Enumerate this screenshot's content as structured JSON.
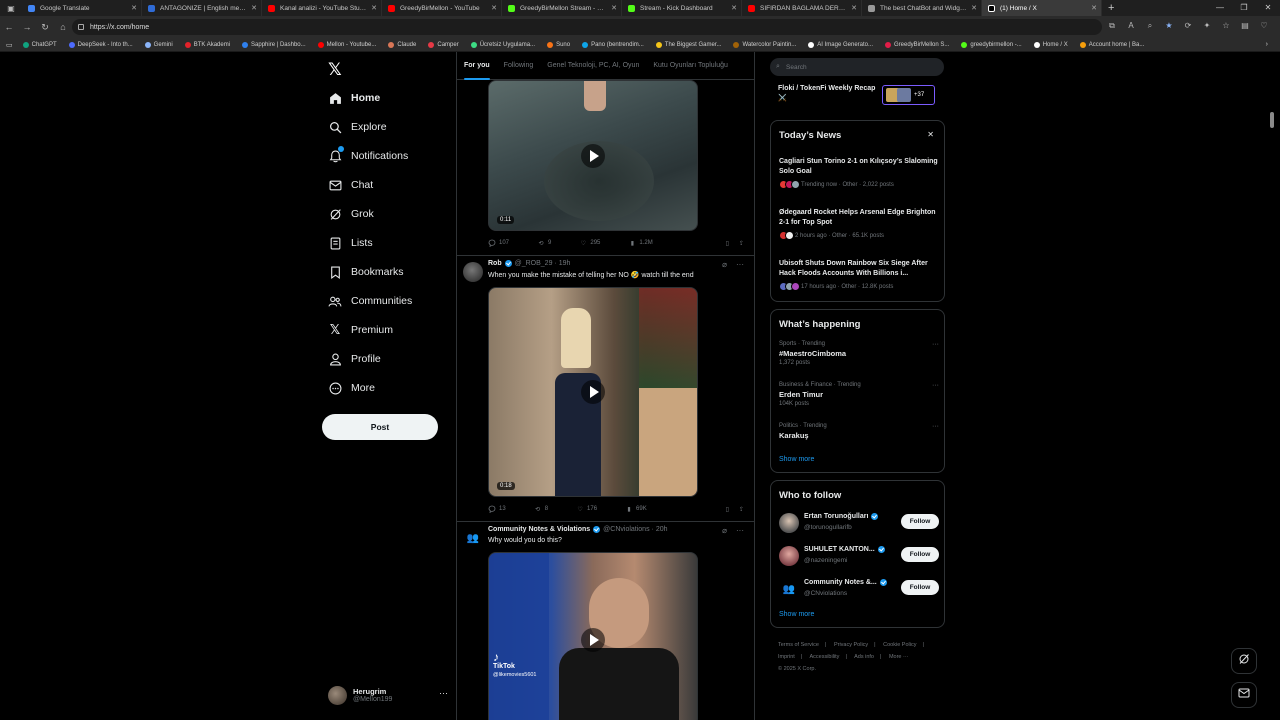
{
  "browser": {
    "tabs": [
      {
        "title": "Google Translate",
        "color": "#4285f4"
      },
      {
        "title": "ANTAGONIZE | English meaning - ...",
        "color": "#2f6bd6"
      },
      {
        "title": "Kanal analizi - YouTube Studio",
        "color": "#ff0000"
      },
      {
        "title": "GreedyBirMellon - YouTube",
        "color": "#ff0000"
      },
      {
        "title": "GreedyBirMellon Stream - Watch ...",
        "color": "#53fc18"
      },
      {
        "title": "Stream - Kick Dashboard",
        "color": "#53fc18"
      },
      {
        "title": "SIFIRDAN BAĞLAMA DERSİ 3 (EN...",
        "color": "#ff0000"
      },
      {
        "title": "The best ChatBot and Widgets for ...",
        "color": "#999999"
      },
      {
        "title": "(1) Home / X",
        "color": "#ffffff"
      }
    ],
    "url": "https://x.com/home",
    "bookmarks": [
      {
        "label": "ChatGPT",
        "color": "#10a37f"
      },
      {
        "label": "DeepSeek - Into th...",
        "color": "#4d6bfe"
      },
      {
        "label": "Gemini",
        "color": "#8ab4f8"
      },
      {
        "label": "BTK Akademi",
        "color": "#e2222a"
      },
      {
        "label": "Sapphire | Dashbo...",
        "color": "#2f80ed"
      },
      {
        "label": "Mellon - Youtube...",
        "color": "#ff0000"
      },
      {
        "label": "Claude",
        "color": "#d97757"
      },
      {
        "label": "Camper",
        "color": "#e63946"
      },
      {
        "label": "Ücretsiz Uygulama...",
        "color": "#3ddc84"
      },
      {
        "label": "Suno",
        "color": "#f97316"
      },
      {
        "label": "Pano (bentrendim...",
        "color": "#0ea5e9"
      },
      {
        "label": "The Biggest Gamer...",
        "color": "#f5c518"
      },
      {
        "label": "Watercolor Paintin...",
        "color": "#a16207"
      },
      {
        "label": "AI Image Generato...",
        "color": "#ffffff"
      },
      {
        "label": "GreedyBirMellon S...",
        "color": "#e11d48"
      },
      {
        "label": "greedybirmellon -...",
        "color": "#53fc18"
      },
      {
        "label": "Home / X",
        "color": "#ffffff"
      },
      {
        "label": "Account home | Ba...",
        "color": "#f59e0b"
      }
    ]
  },
  "nav": {
    "items": [
      {
        "label": "Home",
        "icon": "home-icon"
      },
      {
        "label": "Explore",
        "icon": "search-icon"
      },
      {
        "label": "Notifications",
        "icon": "bell-icon"
      },
      {
        "label": "Chat",
        "icon": "mail-icon"
      },
      {
        "label": "Grok",
        "icon": "grok-icon"
      },
      {
        "label": "Lists",
        "icon": "list-icon"
      },
      {
        "label": "Bookmarks",
        "icon": "bookmark-icon"
      },
      {
        "label": "Communities",
        "icon": "people-icon"
      },
      {
        "label": "Premium",
        "icon": "x-icon"
      },
      {
        "label": "Profile",
        "icon": "person-icon"
      },
      {
        "label": "More",
        "icon": "more-circle-icon"
      }
    ],
    "post_label": "Post",
    "user": {
      "name": "Herugrim",
      "handle": "@Mellon199"
    }
  },
  "feed": {
    "tabs": [
      "For you",
      "Following",
      "Genel Teknoloji, PC, AI, Oyun",
      "Kutu Oyunları Topluluğu"
    ],
    "tweet0": {
      "duration": "0:11",
      "replies": "107",
      "reposts": "9",
      "likes": "295",
      "views": "1.2M"
    },
    "tweet1": {
      "name": "Rob",
      "handle": "@_ROB_29",
      "time": "19h",
      "text": "When you make the mistake of telling her NO 🤣 watch till the end",
      "duration": "0:18",
      "replies": "13",
      "reposts": "8",
      "likes": "176",
      "views": "69K"
    },
    "tweet2": {
      "name": "Community Notes & Violations",
      "handle": "@CNviolations",
      "time": "20h",
      "text": "Why would you do this?",
      "overlay": "TikTok",
      "overlay_handle": "@likemovies5601"
    }
  },
  "sidebar": {
    "search_placeholder": "Search",
    "promo": {
      "title": "Floki / TokenFi Weekly Recap ⚔️",
      "count": "+37"
    },
    "news": {
      "title": "Today’s News",
      "items": [
        {
          "headline": "Cagliari Stun Torino 2-1 on Kılıçsoy’s Slaloming Solo Goal",
          "meta": "Trending now · Other · 2,022 posts"
        },
        {
          "headline": "Ødegaard Rocket Helps Arsenal Edge Brighton 2-1 for Top Spot",
          "meta": "2 hours ago · Other · 65.1K posts"
        },
        {
          "headline": "Ubisoft Shuts Down Rainbow Six Siege After Hack Floods Accounts With Billions i...",
          "meta": "17 hours ago · Other · 12.8K posts"
        }
      ]
    },
    "happening": {
      "title": "What’s happening",
      "trends": [
        {
          "category": "Sports · Trending",
          "name": "#MaestroCimboma",
          "posts": "1,372 posts"
        },
        {
          "category": "Business & Finance · Trending",
          "name": "Erden Timur",
          "posts": "104K posts"
        },
        {
          "category": "Politics · Trending",
          "name": "Karakuş",
          "posts": ""
        }
      ],
      "show_more": "Show more"
    },
    "who_to_follow": {
      "title": "Who to follow",
      "accounts": [
        {
          "name": "Ertan Torunoğulları",
          "handle": "@torunogullarifb"
        },
        {
          "name": "SUHULET KANTON...",
          "handle": "@nazeningemi"
        },
        {
          "name": "Community Notes &...",
          "handle": "@CNviolations"
        }
      ],
      "follow_label": "Follow",
      "show_more": "Show more"
    },
    "footer": {
      "links": [
        "Terms of Service",
        "Privacy Policy",
        "Cookie Policy",
        "Imprint",
        "Accessibility",
        "Ads info",
        "More ···"
      ],
      "copyright": "© 2025 X Corp."
    }
  }
}
